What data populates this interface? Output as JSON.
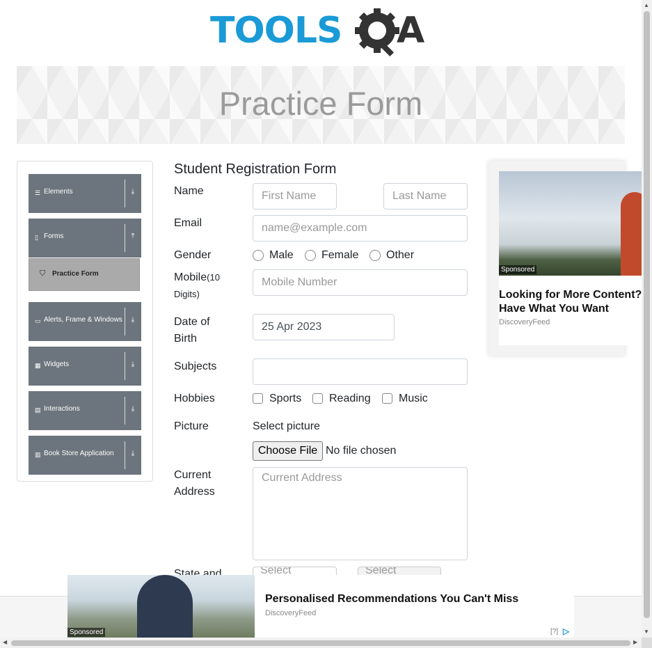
{
  "header": {
    "logo_text_1": "TOOLS",
    "logo_text_2": "A",
    "logo_text_q": "Q"
  },
  "banner": {
    "title": "Practice Form"
  },
  "sidebar": {
    "groups": [
      {
        "label": "Elements",
        "icon": "menu-icon",
        "arrow": "⤓"
      },
      {
        "label": "Forms",
        "icon": "doc-icon",
        "arrow": "⤒"
      },
      {
        "label": "Alerts, Frame & Windows",
        "icon": "window-icon",
        "arrow": "⤓"
      },
      {
        "label": "Widgets",
        "icon": "grid-icon",
        "arrow": "⤓"
      },
      {
        "label": "Interactions",
        "icon": "box-icon",
        "arrow": "⤓"
      },
      {
        "label": "Book Store Application",
        "icon": "chart-icon",
        "arrow": "⤓"
      }
    ],
    "active_item": {
      "label": "Practice Form"
    }
  },
  "form": {
    "title": "Student Registration Form",
    "name_label": "Name",
    "first_name_placeholder": "First Name",
    "last_name_placeholder": "Last Name",
    "email_label": "Email",
    "email_placeholder": "name@example.com",
    "gender_label": "Gender",
    "gender_options": [
      "Male",
      "Female",
      "Other"
    ],
    "mobile_label": "Mobile",
    "mobile_hint": "(10 Digits)",
    "mobile_placeholder": "Mobile Number",
    "dob_label_1": "Date of",
    "dob_label_2": "Birth",
    "dob_value": "25 Apr 2023",
    "subjects_label": "Subjects",
    "hobbies_label": "Hobbies",
    "hobby_options": [
      "Sports",
      "Reading",
      "Music"
    ],
    "picture_label": "Picture",
    "select_picture": "Select picture",
    "choose_file": "Choose File",
    "no_file": "No file chosen",
    "address_label_1": "Current",
    "address_label_2": "Address",
    "address_placeholder": "Current Address",
    "state_label": "State and",
    "state_placeholder": "Select",
    "city_placeholder": "Select"
  },
  "side_ad": {
    "badge": "Sponsored",
    "headline": "Looking for More Content? Have What You Want",
    "source": "DiscoveryFeed"
  },
  "bottom_ad": {
    "badge": "Sponsored",
    "headline": "Personalised Recommendations You Can't Miss",
    "source": "DiscoveryFeed",
    "help": "[?]"
  },
  "colors": {
    "brand_blue": "#1a9ad6",
    "sidebar_bg": "#6c757d",
    "active_item_bg": "#aaaaaa"
  }
}
